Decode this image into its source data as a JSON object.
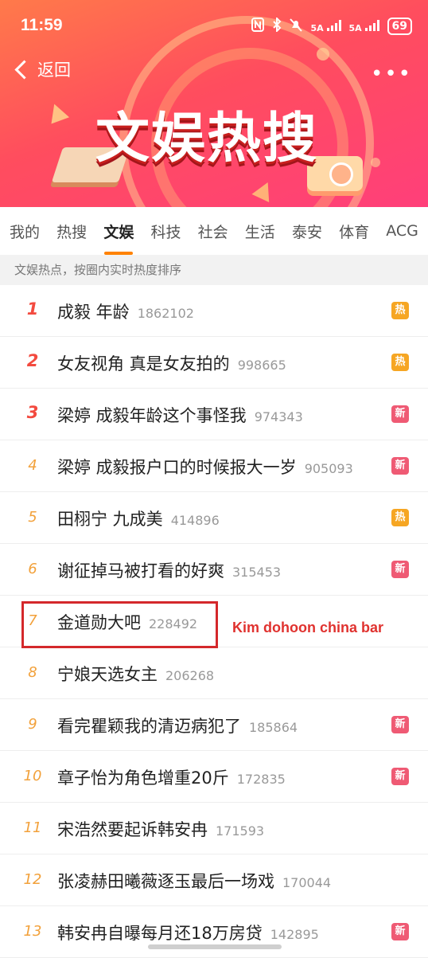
{
  "status_bar": {
    "time": "11:59",
    "icons": [
      "nfc-icon",
      "bluetooth-icon",
      "mute-icon",
      "signal-5a-icon",
      "signal-5a-icon"
    ],
    "signal_label_1": "5A",
    "signal_label_2": "5A",
    "battery": "69"
  },
  "header": {
    "back_label": "返回",
    "more_label": "•••",
    "banner_title": "文娱热搜"
  },
  "tabs": [
    "我的",
    "热搜",
    "文娱",
    "科技",
    "社会",
    "生活",
    "泰安",
    "体育",
    "ACG"
  ],
  "active_tab": "文娱",
  "subtitle": "文娱热点，按圈内实时热度排序",
  "badge_colors": {
    "热": "#f6a623",
    "新": "#ef5a74"
  },
  "items": [
    {
      "rank": "1",
      "title": "成毅 年龄",
      "count": "1862102",
      "badge": "热"
    },
    {
      "rank": "2",
      "title": "女友视角 真是女友拍的",
      "count": "998665",
      "badge": "热"
    },
    {
      "rank": "3",
      "title": "梁婷 成毅年龄这个事怪我",
      "count": "974343",
      "badge": "新"
    },
    {
      "rank": "4",
      "title": "梁婷 成毅报户口的时候报大一岁",
      "count": "905093",
      "badge": "新"
    },
    {
      "rank": "5",
      "title": "田栩宁 九成美",
      "count": "414896",
      "badge": "热"
    },
    {
      "rank": "6",
      "title": "谢征掉马被打看的好爽",
      "count": "315453",
      "badge": "新"
    },
    {
      "rank": "7",
      "title": "金道勋大吧",
      "count": "228492",
      "badge": ""
    },
    {
      "rank": "8",
      "title": "宁娘天选女主",
      "count": "206268",
      "badge": ""
    },
    {
      "rank": "9",
      "title": "看完瞿颖我的清迈病犯了",
      "count": "185864",
      "badge": "新"
    },
    {
      "rank": "10",
      "title": "章子怡为角色增重20斤",
      "count": "172835",
      "badge": "新"
    },
    {
      "rank": "11",
      "title": "宋浩然要起诉韩安冉",
      "count": "171593",
      "badge": ""
    },
    {
      "rank": "12",
      "title": "张凌赫田曦薇逐玉最后一场戏",
      "count": "170044",
      "badge": ""
    },
    {
      "rank": "13",
      "title": "韩安冉自曝每月还18万房贷",
      "count": "142895",
      "badge": "新"
    }
  ],
  "annotation": "Kim dohoon china bar"
}
